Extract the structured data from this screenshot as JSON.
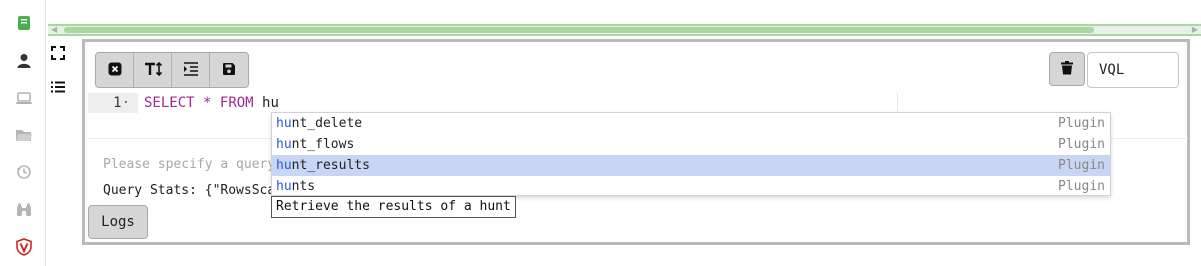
{
  "sidebar": {
    "icons": [
      "notebook-icon",
      "user-icon",
      "laptop-icon",
      "folder-icon",
      "history-icon",
      "binoculars-icon",
      "velociraptor-logo-icon"
    ],
    "colors": {
      "active": "#4caf50",
      "default": "#555555",
      "dim": "#b5b5b5",
      "brand": "#c62828"
    }
  },
  "side_tools": {
    "icons": [
      "fullscreen-icon",
      "list-icon"
    ]
  },
  "toolbar": {
    "buttons": [
      "clear-icon",
      "text-size-icon",
      "indent-icon",
      "save-icon"
    ],
    "trash_icon": "trash-icon",
    "language": "VQL"
  },
  "editor": {
    "line_number": "1",
    "keyword_select": "SELECT",
    "star": "*",
    "keyword_from": "FROM",
    "typed": "hu"
  },
  "output": {
    "placeholder": "Please specify a query",
    "stats": "Query Stats: {\"RowsScanned\""
  },
  "logs_button": "Logs",
  "autocomplete": {
    "match": "hu",
    "items": [
      {
        "rest": "nt_delete",
        "meta": "Plugin"
      },
      {
        "rest": "nt_flows",
        "meta": "Plugin"
      },
      {
        "rest": "nt_results",
        "meta": "Plugin",
        "selected": true
      },
      {
        "rest": "nts",
        "meta": "Plugin"
      }
    ],
    "tooltip": "Retrieve the results of a hunt"
  }
}
